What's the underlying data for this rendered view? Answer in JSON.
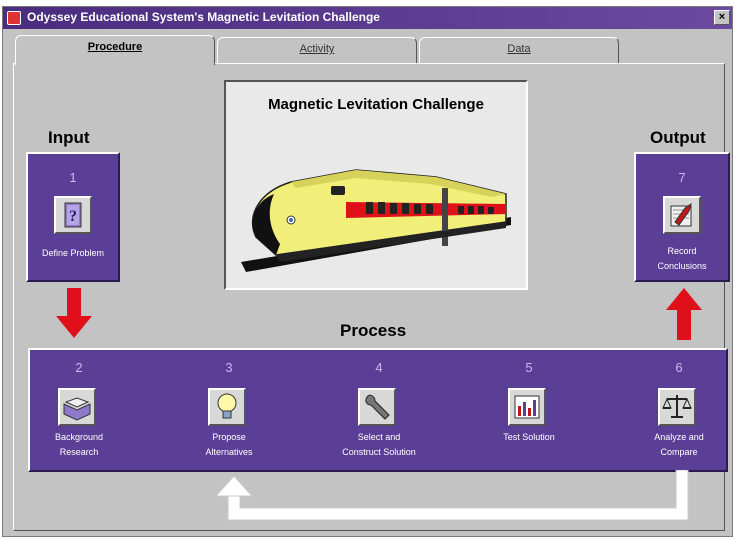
{
  "window": {
    "title": "Odyssey Educational System's Magnetic Levitation Challenge",
    "close_label": "×"
  },
  "tabs": [
    {
      "label": "Procedure",
      "active": true
    },
    {
      "label": "Activity",
      "active": false
    },
    {
      "label": "Data",
      "active": false
    }
  ],
  "center_panel": {
    "title": "Magnetic Levitation Challenge",
    "image": "maglev-train"
  },
  "sections": {
    "input": "Input",
    "output": "Output",
    "process": "Process"
  },
  "steps": {
    "s1": {
      "number": "1",
      "label": "Define Problem",
      "icon": "question-book-icon"
    },
    "s2": {
      "number": "2",
      "label_line1": "Background",
      "label_line2": "Research",
      "icon": "open-book-icon"
    },
    "s3": {
      "number": "3",
      "label_line1": "Propose",
      "label_line2": "Alternatives",
      "icon": "lightbulb-icon"
    },
    "s4": {
      "number": "4",
      "label_line1": "Select and",
      "label_line2": "Construct Solution",
      "icon": "wrench-icon"
    },
    "s5": {
      "number": "5",
      "label_line1": "Test Solution",
      "label_line2": "",
      "icon": "bar-chart-icon"
    },
    "s6": {
      "number": "6",
      "label_line1": "Analyze and",
      "label_line2": "Compare",
      "icon": "balance-scale-icon"
    },
    "s7": {
      "number": "7",
      "label_line1": "Record",
      "label_line2": "Conclusions",
      "icon": "notebook-pencil-icon"
    }
  },
  "colors": {
    "step_purple": "#5b3f96",
    "arrow_red": "#e0101a",
    "return_arrow": "#ffffff",
    "window_gray": "#c3c3c3"
  }
}
